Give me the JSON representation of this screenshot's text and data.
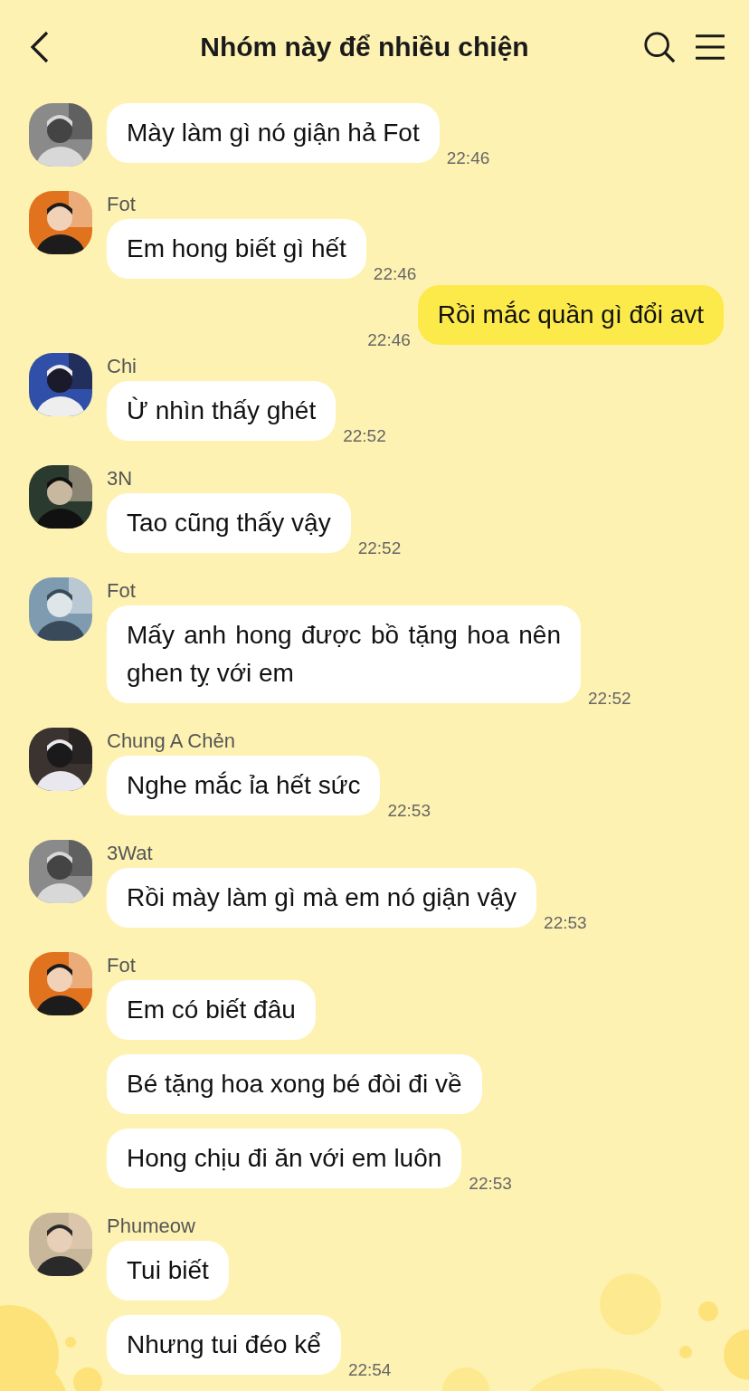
{
  "header": {
    "title": "Nhóm này để nhiều chiện"
  },
  "messages": [
    {
      "kind": "incoming",
      "avatar": {
        "kind": "picture"
      },
      "bubbles": [
        {
          "text": "Mày làm gì nó giận hả Fot",
          "time": "22:46"
        }
      ]
    },
    {
      "kind": "incoming",
      "sender": "Fot",
      "avatar": {
        "kind": "picture"
      },
      "bubbles": [
        {
          "text": "Em hong biết gì hết",
          "time": "22:46"
        }
      ]
    },
    {
      "kind": "outgoing",
      "bubbles": [
        {
          "text": "Rồi mắc quần gì đổi avt",
          "time": "22:46"
        }
      ]
    },
    {
      "kind": "incoming",
      "sender": "Chi",
      "avatar": {
        "kind": "picture"
      },
      "bubbles": [
        {
          "text": "Ừ nhìn thấy ghét",
          "time": "22:52"
        }
      ]
    },
    {
      "kind": "incoming",
      "sender": "3N",
      "avatar": {
        "kind": "picture"
      },
      "bubbles": [
        {
          "text": "Tao cũng thấy vậy",
          "time": "22:52"
        }
      ]
    },
    {
      "kind": "incoming",
      "sender": "Fot",
      "avatar": {
        "kind": "picture"
      },
      "bubbles": [
        {
          "text": "Mấy anh hong được bồ tặng hoa nên ghen tỵ với em",
          "time": "22:52"
        }
      ]
    },
    {
      "kind": "incoming",
      "sender": "Chung A Chẻn",
      "avatar": {
        "kind": "picture"
      },
      "bubbles": [
        {
          "text": "Nghe mắc ỉa hết sức",
          "time": "22:53"
        }
      ]
    },
    {
      "kind": "incoming",
      "sender": "3Wat",
      "avatar": {
        "kind": "picture"
      },
      "bubbles": [
        {
          "text": "Rồi mày làm gì mà em nó giận vậy",
          "time": "22:53"
        }
      ]
    },
    {
      "kind": "incoming",
      "sender": "Fot",
      "avatar": {
        "kind": "picture"
      },
      "bubbles": [
        {
          "text": "Em có biết đâu"
        },
        {
          "text": "Bé tặng hoa xong bé đòi đi về"
        },
        {
          "text": "Hong chịu đi ăn với em luôn",
          "time": "22:53"
        }
      ]
    },
    {
      "kind": "incoming",
      "sender": "Phumeow",
      "avatar": {
        "kind": "picture"
      },
      "bubbles": [
        {
          "text": "Tui biết"
        },
        {
          "text": "Nhưng tui đéo kể",
          "time": "22:54"
        }
      ]
    }
  ]
}
